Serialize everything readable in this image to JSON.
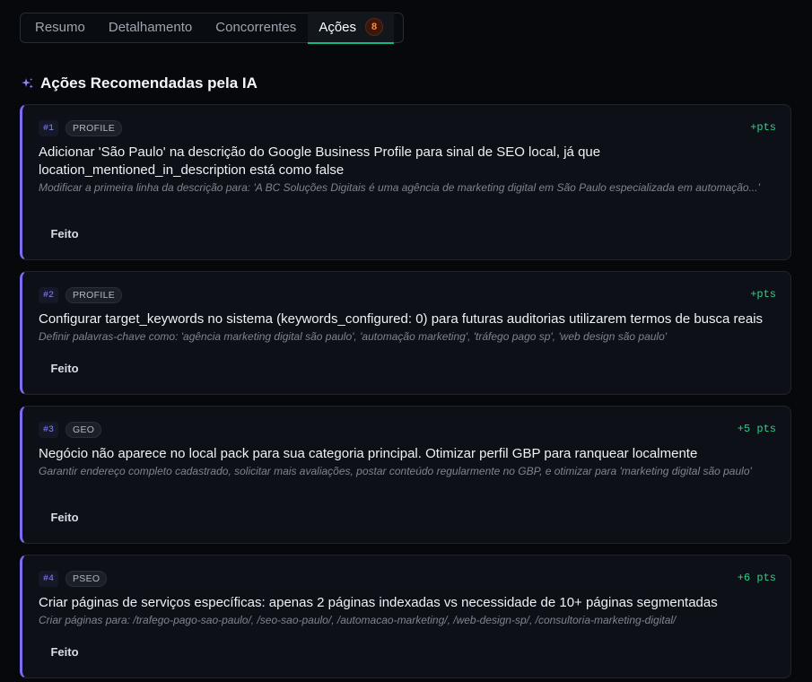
{
  "tabs": [
    {
      "label": "Resumo"
    },
    {
      "label": "Detalhamento"
    },
    {
      "label": "Concorrentes"
    },
    {
      "label": "Ações",
      "badge": "8",
      "active": true
    }
  ],
  "section": {
    "title": "Ações Recomendadas pela IA",
    "icon": "sparkles-icon"
  },
  "actions": [
    {
      "rank": "#1",
      "category": "PROFILE",
      "points": "+pts",
      "title": "Adicionar 'São Paulo' na descrição do Google Business Profile para sinal de SEO local, já que location_mentioned_in_description está como false",
      "description": "Modificar a primeira linha da descrição para: 'A BC Soluções Digitais é uma agência de marketing digital em São Paulo especializada em automação...'",
      "button": "Feito"
    },
    {
      "rank": "#2",
      "category": "PROFILE",
      "points": "+pts",
      "title": "Configurar target_keywords no sistema (keywords_configured: 0) para futuras auditorias utilizarem termos de busca reais",
      "description": "Definir palavras-chave como: 'agência marketing digital são paulo', 'automação marketing', 'tráfego pago sp', 'web design são paulo'",
      "button": "Feito"
    },
    {
      "rank": "#3",
      "category": "GEO",
      "points": "+5 pts",
      "title": "Negócio não aparece no local pack para sua categoria principal. Otimizar perfil GBP para ranquear localmente",
      "description": "Garantir endereço completo cadastrado, solicitar mais avaliações, postar conteúdo regularmente no GBP, e otimizar para 'marketing digital são paulo'",
      "button": "Feito"
    },
    {
      "rank": "#4",
      "category": "PSEO",
      "points": "+6 pts",
      "title": "Criar páginas de serviços específicas: apenas 2 páginas indexadas vs necessidade de 10+ páginas segmentadas",
      "description": "Criar páginas para: /trafego-pago-sao-paulo/, /seo-sao-paulo/, /automacao-marketing/, /web-design-sp/, /consultoria-marketing-digital/",
      "button": "Feito"
    }
  ],
  "colors": {
    "background": "#06080c",
    "card": "#0d1117",
    "accent": "#7c6df2",
    "active_tab_underline": "#12b886",
    "points": "#2bcf8b",
    "badge": "#ff8a3d"
  }
}
